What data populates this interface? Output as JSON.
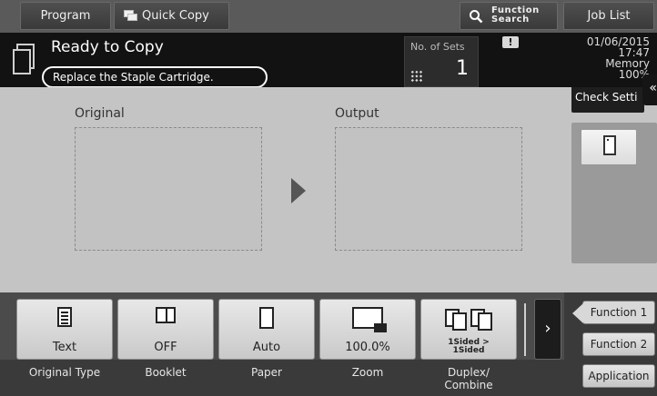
{
  "top_tabs": {
    "program": "Program",
    "quick_copy": "Quick Copy",
    "function_search_line1": "Function",
    "function_search_line2": "Search",
    "job_list": "Job List"
  },
  "status": {
    "title": "Ready to Copy",
    "message": "Replace the Staple Cartridge.",
    "sets_label": "No. of Sets",
    "sets_value": "1",
    "warning_glyph": "!",
    "date": "01/06/2015",
    "time": "17:47",
    "memory_label": "Memory",
    "memory_value": "100%"
  },
  "main": {
    "original_label": "Original",
    "output_label": "Output"
  },
  "right_panel": {
    "check_settings": "Check Setti",
    "collapse_glyph": "«"
  },
  "function_keys": [
    {
      "value": "Text",
      "caption": "Original Type",
      "icon": "document-icon"
    },
    {
      "value": "OFF",
      "caption": "Booklet",
      "icon": "booklet-icon"
    },
    {
      "value": "Auto",
      "caption": "Paper",
      "icon": "paper-icon"
    },
    {
      "value": "100.0%",
      "caption": "Zoom",
      "icon": "zoom-icon"
    },
    {
      "value_line1": "1Sided >",
      "value_line2": "1Sided",
      "caption_line1": "Duplex/",
      "caption_line2": "Combine",
      "icon": "duplex-icon"
    }
  ],
  "nav": {
    "next_glyph": "›",
    "function_1": "Function 1",
    "function_2": "Function 2",
    "application": "Application"
  }
}
